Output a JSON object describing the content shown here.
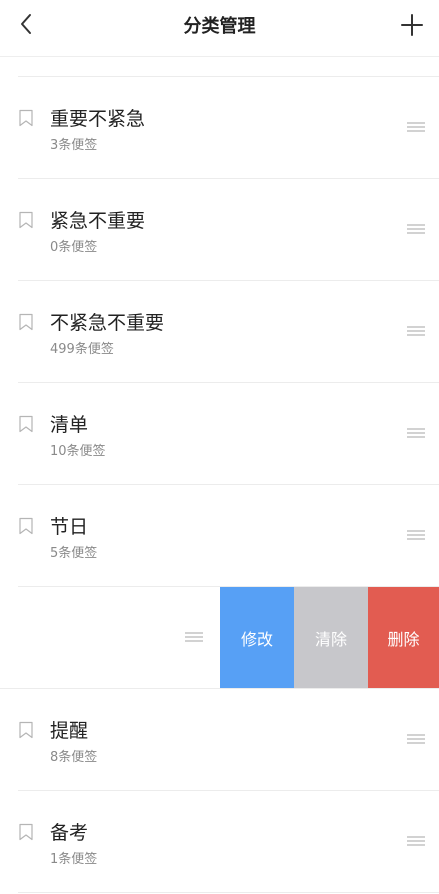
{
  "header": {
    "title": "分类管理",
    "back_icon": "chevron-left-icon",
    "add_icon": "plus-icon"
  },
  "categories": [
    {
      "name": "重要不紧急",
      "count": "3条便签"
    },
    {
      "name": "紧急不重要",
      "count": "0条便签"
    },
    {
      "name": "不紧急不重要",
      "count": "499条便签"
    },
    {
      "name": "清单",
      "count": "10条便签"
    },
    {
      "name": "节日",
      "count": "5条便签"
    },
    {
      "name": "",
      "count": ""
    },
    {
      "name": "提醒",
      "count": "8条便签"
    },
    {
      "name": "备考",
      "count": "1条便签"
    }
  ],
  "swipe_actions": {
    "edit": "修改",
    "clear": "清除",
    "delete": "删除"
  },
  "colors": {
    "edit": "#57a0f5",
    "clear": "#c7c7cb",
    "delete": "#e25c51",
    "divider": "#ececec",
    "secondary_text": "#8a8a8a"
  }
}
